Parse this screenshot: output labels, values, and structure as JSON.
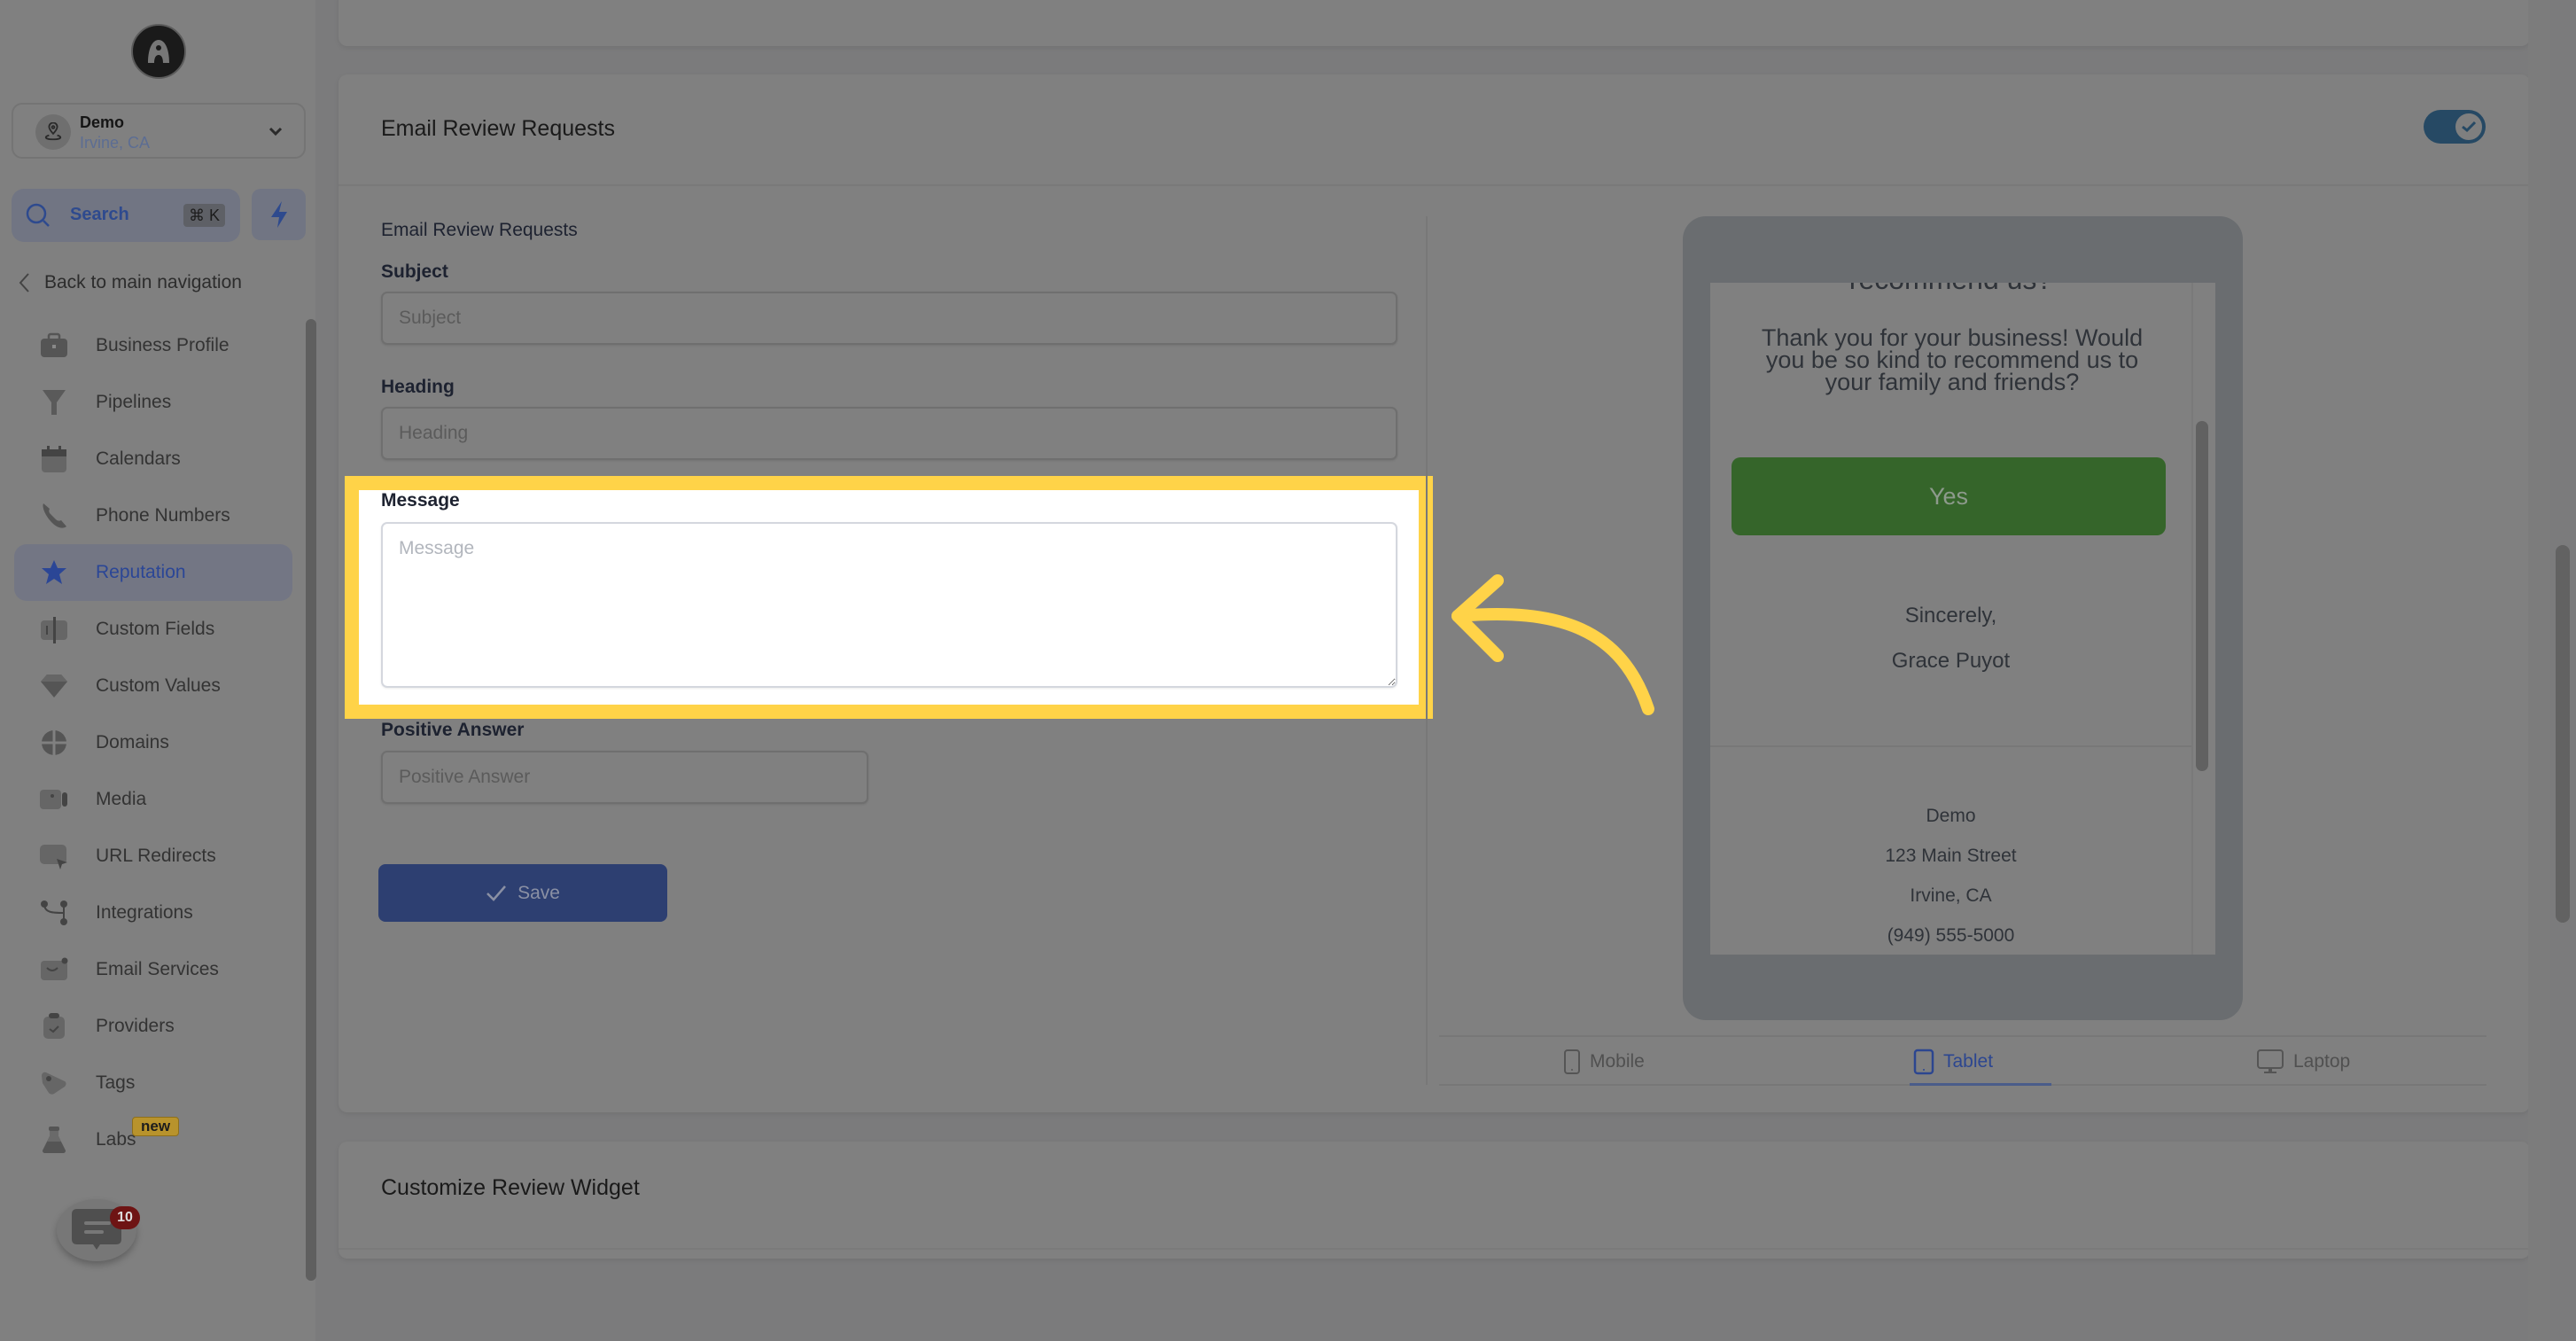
{
  "sidebar": {
    "account": {
      "name": "Demo",
      "location": "Irvine, CA"
    },
    "search": {
      "label": "Search",
      "shortcut": "⌘ K"
    },
    "back_label": "Back to main navigation",
    "items": [
      {
        "label": "Business Profile",
        "icon": "briefcase-icon"
      },
      {
        "label": "Pipelines",
        "icon": "funnel-icon"
      },
      {
        "label": "Calendars",
        "icon": "calendar-icon"
      },
      {
        "label": "Phone Numbers",
        "icon": "phone-icon"
      },
      {
        "label": "Reputation",
        "icon": "star-icon",
        "active": true
      },
      {
        "label": "Custom Fields",
        "icon": "fields-icon"
      },
      {
        "label": "Custom Values",
        "icon": "diamond-icon"
      },
      {
        "label": "Domains",
        "icon": "globe-icon"
      },
      {
        "label": "Media",
        "icon": "video-icon"
      },
      {
        "label": "URL Redirects",
        "icon": "redirect-icon"
      },
      {
        "label": "Integrations",
        "icon": "integrations-icon"
      },
      {
        "label": "Email Services",
        "icon": "mail-icon"
      },
      {
        "label": "Providers",
        "icon": "clipboard-icon"
      },
      {
        "label": "Tags",
        "icon": "tag-icon"
      },
      {
        "label": "Labs",
        "icon": "flask-icon",
        "badge": "new"
      }
    ],
    "chat_badge": "10"
  },
  "main": {
    "card_title": "Email Review Requests",
    "toggle_on": true,
    "section_title": "Email Review Requests",
    "fields": {
      "subject": {
        "label": "Subject",
        "placeholder": "Subject",
        "value": ""
      },
      "heading": {
        "label": "Heading",
        "placeholder": "Heading",
        "value": ""
      },
      "message": {
        "label": "Message",
        "placeholder": "Message",
        "value": ""
      },
      "positive_answer": {
        "label": "Positive Answer",
        "placeholder": "Positive Answer",
        "value": ""
      }
    },
    "save_label": "Save",
    "next_card_title": "Customize Review Widget"
  },
  "preview": {
    "cut_heading": "recommend us?",
    "body": "Thank you for your business! Would you be so kind to recommend us to your family and friends?",
    "yes_label": "Yes",
    "closing": "Sincerely,",
    "signer": "Grace Puyot",
    "footer": [
      "Demo",
      "123 Main Street",
      "Irvine, CA",
      "(949) 555-5000"
    ],
    "tabs": [
      {
        "label": "Mobile",
        "icon": "mobile-icon"
      },
      {
        "label": "Tablet",
        "icon": "tablet-icon",
        "active": true
      },
      {
        "label": "Laptop",
        "icon": "laptop-icon"
      }
    ]
  },
  "colors": {
    "highlight": "#ffd348",
    "accent": "#2b4696",
    "yes_button": "#35652a"
  }
}
